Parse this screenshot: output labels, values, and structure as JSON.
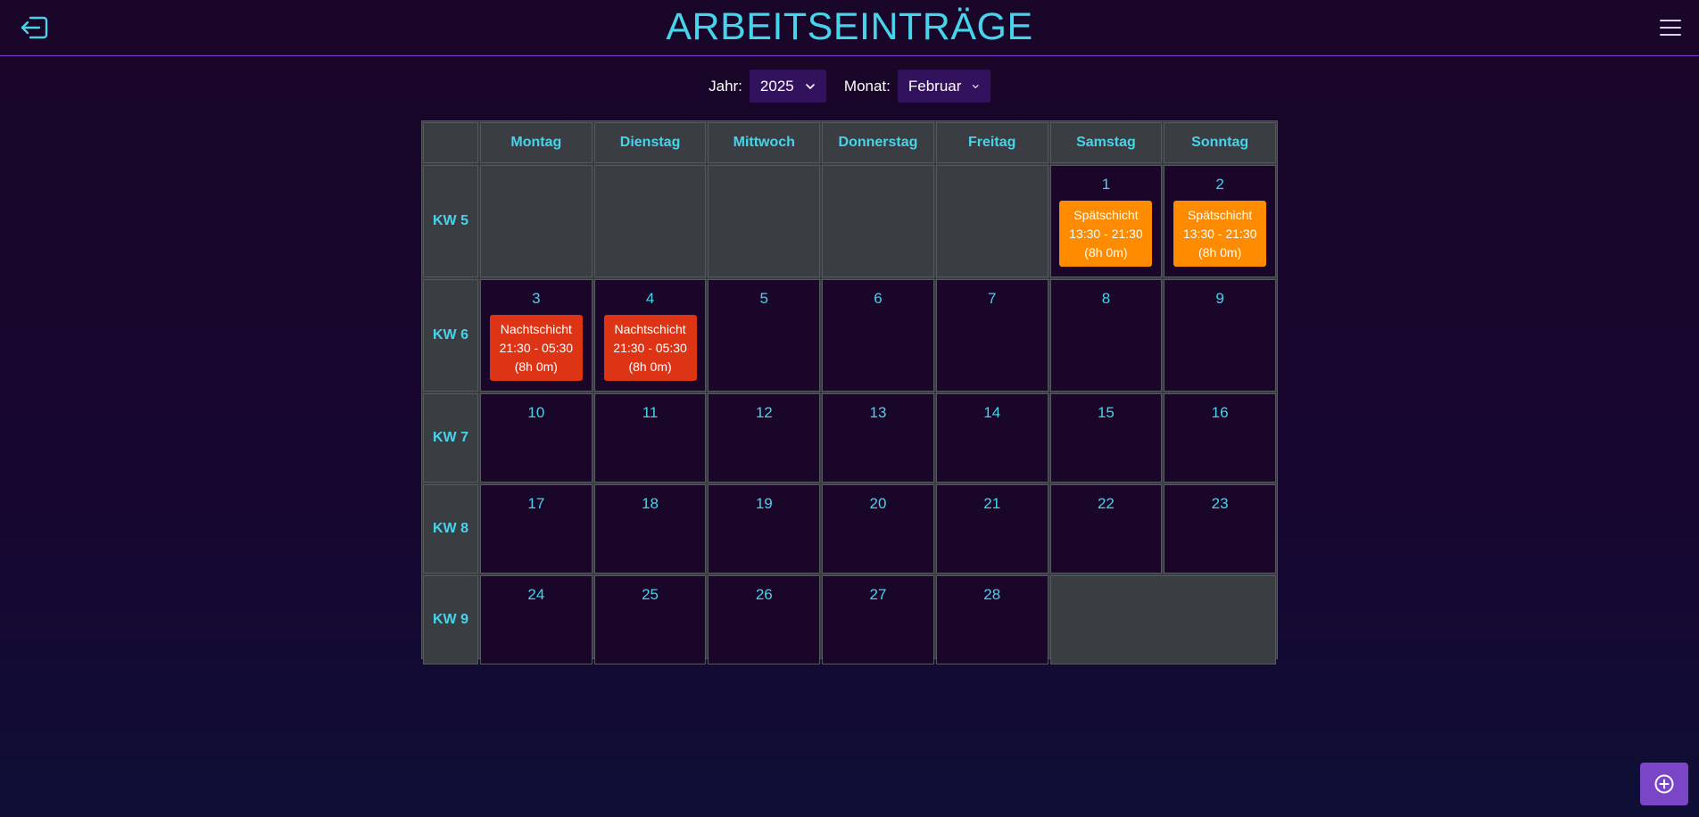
{
  "header": {
    "title": "ARBEITSEINTRÄGE",
    "logout_icon": "logout-icon",
    "menu_icon": "hamburger-menu-icon"
  },
  "filters": {
    "year_label": "Jahr:",
    "year_value": "2025",
    "month_label": "Monat:",
    "month_value": "Februar"
  },
  "calendar": {
    "weekdays": [
      "Montag",
      "Dienstag",
      "Mittwoch",
      "Donnerstag",
      "Freitag",
      "Samstag",
      "Sonntag"
    ],
    "weeks": [
      {
        "label": "KW 5",
        "days": [
          null,
          null,
          null,
          null,
          null,
          {
            "day": "1",
            "shifts": [
              {
                "name": "Spätschicht",
                "time": "13:30 - 21:30",
                "duration": "(8h 0m)",
                "kind": "late"
              }
            ]
          },
          {
            "day": "2",
            "shifts": [
              {
                "name": "Spätschicht",
                "time": "13:30 - 21:30",
                "duration": "(8h 0m)",
                "kind": "late"
              }
            ]
          }
        ]
      },
      {
        "label": "KW 6",
        "days": [
          {
            "day": "3",
            "shifts": [
              {
                "name": "Nachtschicht",
                "time": "21:30 - 05:30",
                "duration": "(8h 0m)",
                "kind": "night"
              }
            ]
          },
          {
            "day": "4",
            "shifts": [
              {
                "name": "Nachtschicht",
                "time": "21:30 - 05:30",
                "duration": "(8h 0m)",
                "kind": "night"
              }
            ]
          },
          {
            "day": "5",
            "shifts": []
          },
          {
            "day": "6",
            "shifts": []
          },
          {
            "day": "7",
            "shifts": []
          },
          {
            "day": "8",
            "shifts": []
          },
          {
            "day": "9",
            "shifts": []
          }
        ]
      },
      {
        "label": "KW 7",
        "days": [
          {
            "day": "10",
            "shifts": []
          },
          {
            "day": "11",
            "shifts": []
          },
          {
            "day": "12",
            "shifts": []
          },
          {
            "day": "13",
            "shifts": []
          },
          {
            "day": "14",
            "shifts": []
          },
          {
            "day": "15",
            "shifts": []
          },
          {
            "day": "16",
            "shifts": []
          }
        ]
      },
      {
        "label": "KW 8",
        "days": [
          {
            "day": "17",
            "shifts": []
          },
          {
            "day": "18",
            "shifts": []
          },
          {
            "day": "19",
            "shifts": []
          },
          {
            "day": "20",
            "shifts": []
          },
          {
            "day": "21",
            "shifts": []
          },
          {
            "day": "22",
            "shifts": []
          },
          {
            "day": "23",
            "shifts": []
          }
        ]
      },
      {
        "label": "KW 9",
        "days": [
          {
            "day": "24",
            "shifts": []
          },
          {
            "day": "25",
            "shifts": []
          },
          {
            "day": "26",
            "shifts": []
          },
          {
            "day": "27",
            "shifts": []
          },
          {
            "day": "28",
            "shifts": []
          },
          null,
          null
        ]
      }
    ]
  },
  "colors": {
    "accent": "#47d4ea",
    "background": "#190628",
    "late_shift": "#ff8c00",
    "night_shift": "#dc3415",
    "add_button": "#7a45c7"
  },
  "add_button": {
    "icon": "plus-circle-icon"
  }
}
